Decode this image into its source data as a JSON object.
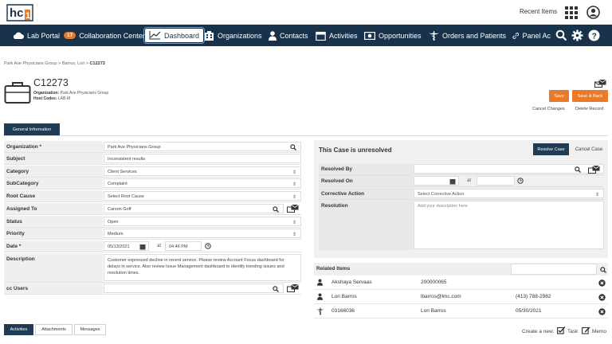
{
  "brand": {
    "logo_text": "hc1",
    "accent": "#e97a2a",
    "nav_bg": "#17324a"
  },
  "topbar": {
    "recent_items": "Recent Items"
  },
  "nav": {
    "items": [
      {
        "label": "Lab Portal",
        "icon": "cloud-icon"
      },
      {
        "label": "Collaboration Center",
        "badge": "17"
      },
      {
        "label": "Dashboard",
        "icon": "chart-line-icon",
        "active": true
      },
      {
        "label": "Organizations",
        "icon": "building-icon"
      },
      {
        "label": "Contacts",
        "icon": "person-icon"
      },
      {
        "label": "Activities",
        "icon": "calendar-icon"
      },
      {
        "label": "Opportunities",
        "icon": "money-icon"
      },
      {
        "label": "Orders and Patients",
        "icon": "caduceus-icon"
      },
      {
        "label": "Panel Ac",
        "icon": "link-icon"
      }
    ]
  },
  "breadcrumb": {
    "org": "Park Ave Physicians Group",
    "contact": "Barros, Lori",
    "current": "C12273"
  },
  "case": {
    "id": "C12273",
    "organization_label": "Organization:",
    "organization": "Park Ave Physicians Group",
    "host_codes_label": "Host Codes:",
    "host_codes": "LAB-M"
  },
  "actions": {
    "save": "Save",
    "save_back": "Save & Back",
    "cancel_changes": "Cancel Changes",
    "delete_record": "Delete Record"
  },
  "tabs": {
    "general": "General Information"
  },
  "form": {
    "organization": {
      "label": "Organization *",
      "value": "Park Ave Physicians Group"
    },
    "subject": {
      "label": "Subject",
      "value": "Inconsistent results"
    },
    "category": {
      "label": "Category",
      "value": "Client Services"
    },
    "subcategory": {
      "label": "SubCategory",
      "value": "Complaint"
    },
    "root_cause": {
      "label": "Root Cause",
      "value": "Select Root Cause"
    },
    "assigned_to": {
      "label": "Assigned To",
      "value": "Carson Goff"
    },
    "status": {
      "label": "Status",
      "value": "Open"
    },
    "priority": {
      "label": "Priority",
      "value": "Medium"
    },
    "date": {
      "label": "Date *",
      "value": "05/13/2021",
      "at": "at",
      "time": "04:46 PM"
    },
    "description": {
      "label": "Description",
      "value": "Customer expressed decline in recent service. Please review Account Focus dashboard for delays in service. Also review Issue Management dashboard to identify trending issues and resolution times."
    },
    "cc_users": {
      "label": "cc Users",
      "value": ""
    }
  },
  "resolve_panel": {
    "title": "This Case is unresolved",
    "resolve_button": "Resolve Case",
    "cancel_button": "Cancel Case",
    "resolved_by": {
      "label": "Resolved By",
      "value": ""
    },
    "resolved_on": {
      "label": "Resolved On",
      "at": "at"
    },
    "corrective_action": {
      "label": "Corrective Action",
      "value": "Select Corrective Action"
    },
    "resolution": {
      "label": "Resolution",
      "placeholder": "Add your description here"
    }
  },
  "related": {
    "title": "Related Items",
    "rows": [
      {
        "icon": "person-icon",
        "name": "Akshaya Servaas",
        "detail": "200000065",
        "extra": ""
      },
      {
        "icon": "person-icon",
        "name": "Lori Barros",
        "detail": "lbarros@lmc.com",
        "extra": "(413) 788-2982"
      },
      {
        "icon": "caduceus-icon",
        "name": "03166036",
        "detail": "Lori Barros",
        "extra": "05/30/2021"
      }
    ]
  },
  "bottom_tabs": [
    "Activities",
    "Attachments",
    "Messages"
  ],
  "create": {
    "label": "Create a new:",
    "task": "Task",
    "memo": "Memo"
  }
}
